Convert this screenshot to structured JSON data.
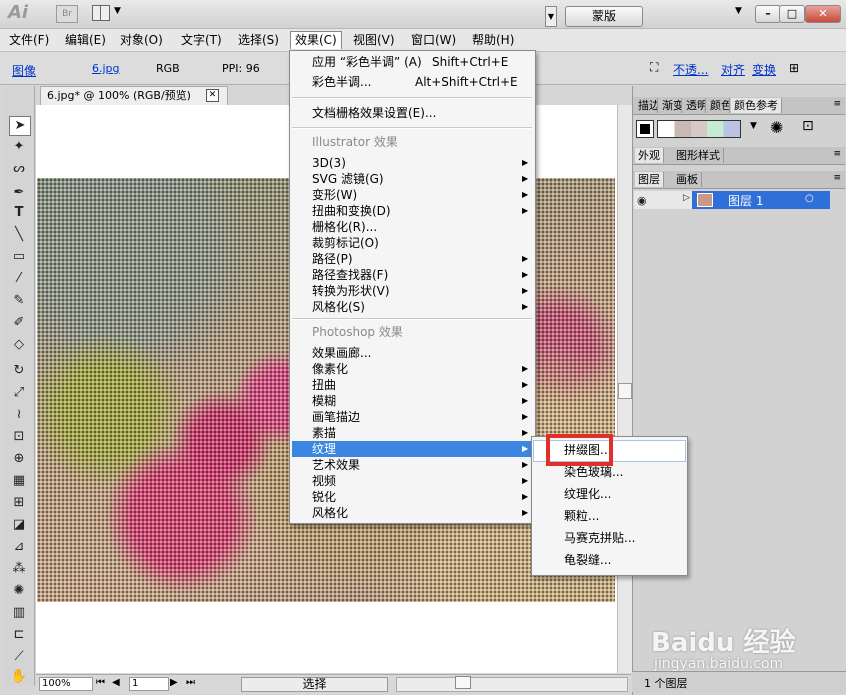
{
  "titlebar": {
    "logo": "Ai",
    "bridge": "Br",
    "buttons": {
      "min": "–",
      "max": "□",
      "close": "✕"
    }
  },
  "menubar": [
    {
      "label": "文件(F)"
    },
    {
      "label": "编辑(E)"
    },
    {
      "label": "对象(O)"
    },
    {
      "label": "文字(T)"
    },
    {
      "label": "选择(S)"
    },
    {
      "label": "效果(C)"
    },
    {
      "label": "视图(V)"
    },
    {
      "label": "窗口(W)"
    },
    {
      "label": "帮助(H)"
    }
  ],
  "controlbar": {
    "image_label": "图像",
    "file": "6.jpg",
    "mode": "RGB",
    "ppi": "PPI: 96",
    "mask_button": "蒙版",
    "opacity_link": "不透...",
    "align_link": "对齐",
    "transform_link": "变换"
  },
  "document": {
    "tab_title": "6.jpg* @ 100% (RGB/预览)",
    "close": "✕"
  },
  "statusbar": {
    "zoom": "100%",
    "page": "1",
    "status": "选择"
  },
  "effect_menu": {
    "apply_last": "应用 “彩色半调” (A)",
    "apply_last_shortcut": "Shift+Ctrl+E",
    "last_effect": "彩色半调...",
    "last_effect_shortcut": "Alt+Shift+Ctrl+E",
    "raster_settings": "文档栅格效果设置(E)...",
    "illustrator_header": "Illustrator 效果",
    "illustrator_items": [
      "3D(3)",
      "SVG 滤镜(G)",
      "变形(W)",
      "扭曲和变换(D)",
      "栅格化(R)...",
      "裁剪标记(O)",
      "路径(P)",
      "路径查找器(F)",
      "转换为形状(V)",
      "风格化(S)"
    ],
    "photoshop_header": "Photoshop 效果",
    "photoshop_items": [
      "效果画廊...",
      "像素化",
      "扭曲",
      "模糊",
      "画笔描边",
      "素描",
      "纹理",
      "艺术效果",
      "视频",
      "锐化",
      "风格化"
    ],
    "highlighted": "纹理"
  },
  "texture_submenu": {
    "items": [
      "拼缀图...",
      "染色玻璃...",
      "纹理化...",
      "颗粒...",
      "马赛克拼贴...",
      "龟裂缝..."
    ]
  },
  "panels": {
    "top_tabs": [
      "描边",
      "渐变",
      "透明",
      "颜色",
      "颜色参考"
    ],
    "mid_tabs": [
      "外观",
      "图形样式"
    ],
    "layer_tabs": [
      "图层",
      "画板"
    ],
    "layer_name": "图层 1",
    "layers_count": "1 个图层"
  },
  "watermark": {
    "logo": "Baidu 经验",
    "sub": "jingyan.baidu.com"
  },
  "colors": {
    "accent": "#3b86e0",
    "highlight_box": "#e0302a",
    "layer_selected": "#2f6fd8"
  }
}
